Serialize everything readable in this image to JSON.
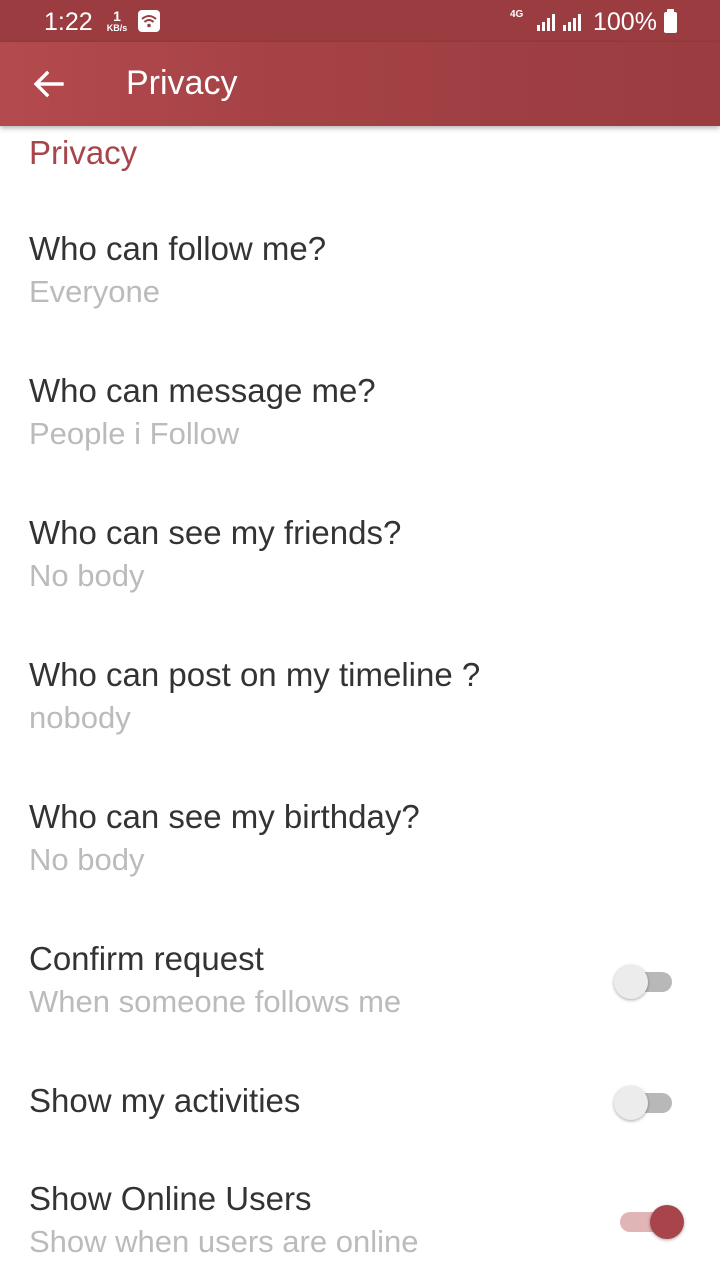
{
  "status_bar": {
    "time": "1:22",
    "net_speed_value": "1",
    "net_speed_unit": "KB/s",
    "network_type": "4G",
    "battery": "100%"
  },
  "app_bar": {
    "title": "Privacy"
  },
  "section": {
    "header": "Privacy"
  },
  "preferences": [
    {
      "title": "Who can follow me?",
      "summary": "Everyone"
    },
    {
      "title": "Who can message me?",
      "summary": "People i Follow"
    },
    {
      "title": "Who can see my friends?",
      "summary": "No body"
    },
    {
      "title": "Who can post on my timeline ?",
      "summary": "nobody"
    },
    {
      "title": "Who can see my birthday?",
      "summary": "No body"
    },
    {
      "title": "Confirm request",
      "summary": "When someone follows me",
      "toggle": false
    },
    {
      "title": "Show my activities",
      "toggle": false
    },
    {
      "title": "Show Online Users",
      "summary": "Show when users are online",
      "toggle": true
    }
  ],
  "colors": {
    "status_bar": "#9a3c40",
    "app_bar": "#a54246",
    "accent": "#a8454a",
    "title_text": "#333333",
    "summary_text": "#bbbbbb"
  }
}
